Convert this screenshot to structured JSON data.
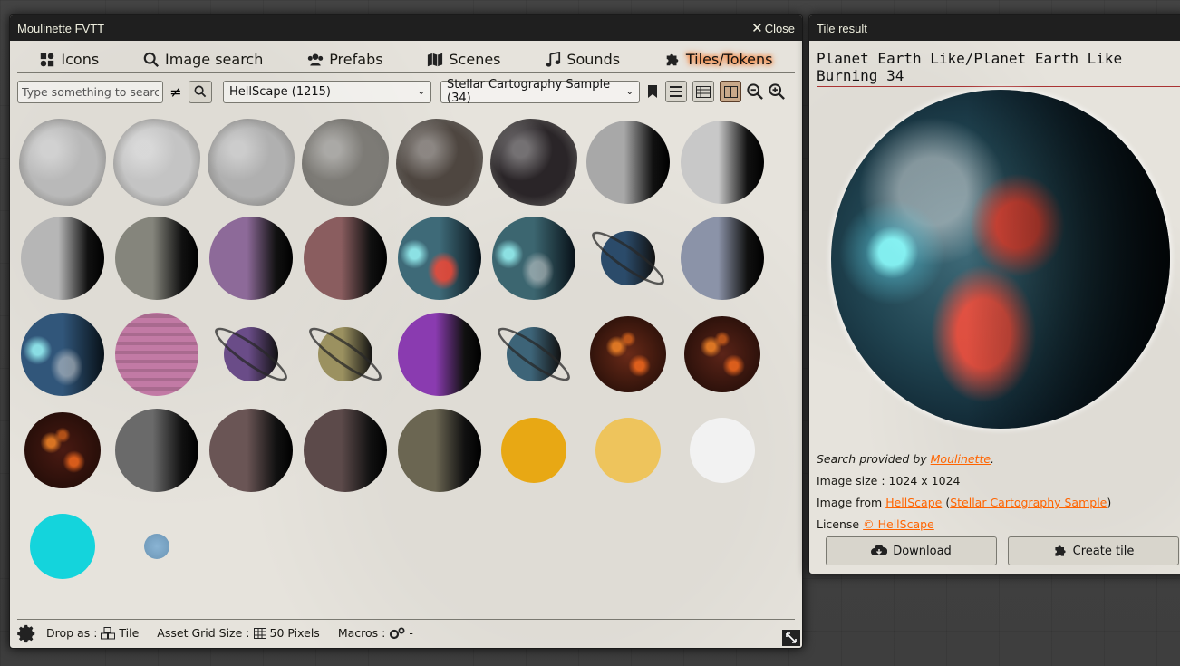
{
  "main_window": {
    "title": "Moulinette FVTT",
    "close_label": "Close",
    "tabs": [
      {
        "label": "Icons",
        "icon": "puzzle-icons"
      },
      {
        "label": "Image search",
        "icon": "search-icon"
      },
      {
        "label": "Prefabs",
        "icon": "users-icon"
      },
      {
        "label": "Scenes",
        "icon": "map-icon"
      },
      {
        "label": "Sounds",
        "icon": "music-icon"
      },
      {
        "label": "Tiles/Tokens",
        "icon": "puzzle-piece-icon",
        "active": true
      }
    ],
    "toolbar": {
      "search_placeholder": "Type something to search...",
      "not_equal": "≠",
      "creator_select": "HellScape (1215)",
      "pack_select": "Stellar Cartography Sample (34)",
      "active_view": "grid"
    },
    "footer": {
      "drop_as_label": "Drop as :",
      "drop_as_value": "Tile",
      "grid_size_label": "Asset Grid Size :",
      "grid_size_value": "50 Pixels",
      "macros_label": "Macros :",
      "macros_value": "-"
    }
  },
  "tile_window": {
    "title": "Tile result",
    "asset_title": "Planet Earth Like/Planet Earth Like Burning 34",
    "search_provided_prefix": "Search provided by",
    "search_provider": "Moulinette",
    "search_provided_suffix": ".",
    "image_size_label": "Image size : 1024 x 1024",
    "image_from_label": "Image from",
    "image_from_creator": "HellScape",
    "image_from_pack": "Stellar Cartography Sample",
    "license_label": "License",
    "license_value": "© HellScape",
    "download_label": "Download",
    "create_tile_label": "Create tile"
  },
  "thumbnails": [
    {
      "kind": "asteroid",
      "color": "#b9b9b9"
    },
    {
      "kind": "asteroid",
      "color": "#c4c4c4"
    },
    {
      "kind": "asteroid",
      "color": "#b0b0b0"
    },
    {
      "kind": "asteroid",
      "color": "#7d7b76"
    },
    {
      "kind": "asteroid",
      "color": "#4e4640"
    },
    {
      "kind": "asteroid",
      "color": "#2a2528"
    },
    {
      "kind": "moon",
      "color": "#a8a8a8"
    },
    {
      "kind": "moon",
      "color": "#c8c8c8"
    },
    {
      "kind": "moon",
      "color": "#b6b6b6"
    },
    {
      "kind": "moon",
      "color": "#85857c"
    },
    {
      "kind": "moon",
      "color": "#8d6a99"
    },
    {
      "kind": "moon",
      "color": "#8a5d5f"
    },
    {
      "kind": "earth-burning",
      "color": "#3e6a78"
    },
    {
      "kind": "earth",
      "color": "#3c6670"
    },
    {
      "kind": "ringed",
      "color": "#2b4b6a"
    },
    {
      "kind": "moon",
      "color": "#8b93a8"
    },
    {
      "kind": "earth",
      "color": "#31567a"
    },
    {
      "kind": "banded",
      "color": "#c27aa5"
    },
    {
      "kind": "ringed",
      "color": "#6a4c88"
    },
    {
      "kind": "ringed",
      "color": "#9b9160"
    },
    {
      "kind": "moon",
      "color": "#8a3bb0"
    },
    {
      "kind": "ringed",
      "color": "#3d6478"
    },
    {
      "kind": "lava",
      "color": "#6a2a18"
    },
    {
      "kind": "lava",
      "color": "#5c2418"
    },
    {
      "kind": "lava",
      "color": "#4a1a12"
    },
    {
      "kind": "moon",
      "color": "#6a6a6a"
    },
    {
      "kind": "moon",
      "color": "#6a5555"
    },
    {
      "kind": "moon",
      "color": "#5c4a4a"
    },
    {
      "kind": "moon",
      "color": "#6b6652"
    },
    {
      "kind": "sun",
      "color": "#e8a814"
    },
    {
      "kind": "sun",
      "color": "#eec45c"
    },
    {
      "kind": "sun",
      "color": "#f2f2f2"
    },
    {
      "kind": "sun",
      "color": "#14d4dc"
    },
    {
      "kind": "small",
      "color": "#8ab4d4"
    }
  ],
  "accent_color": "#ff6400"
}
